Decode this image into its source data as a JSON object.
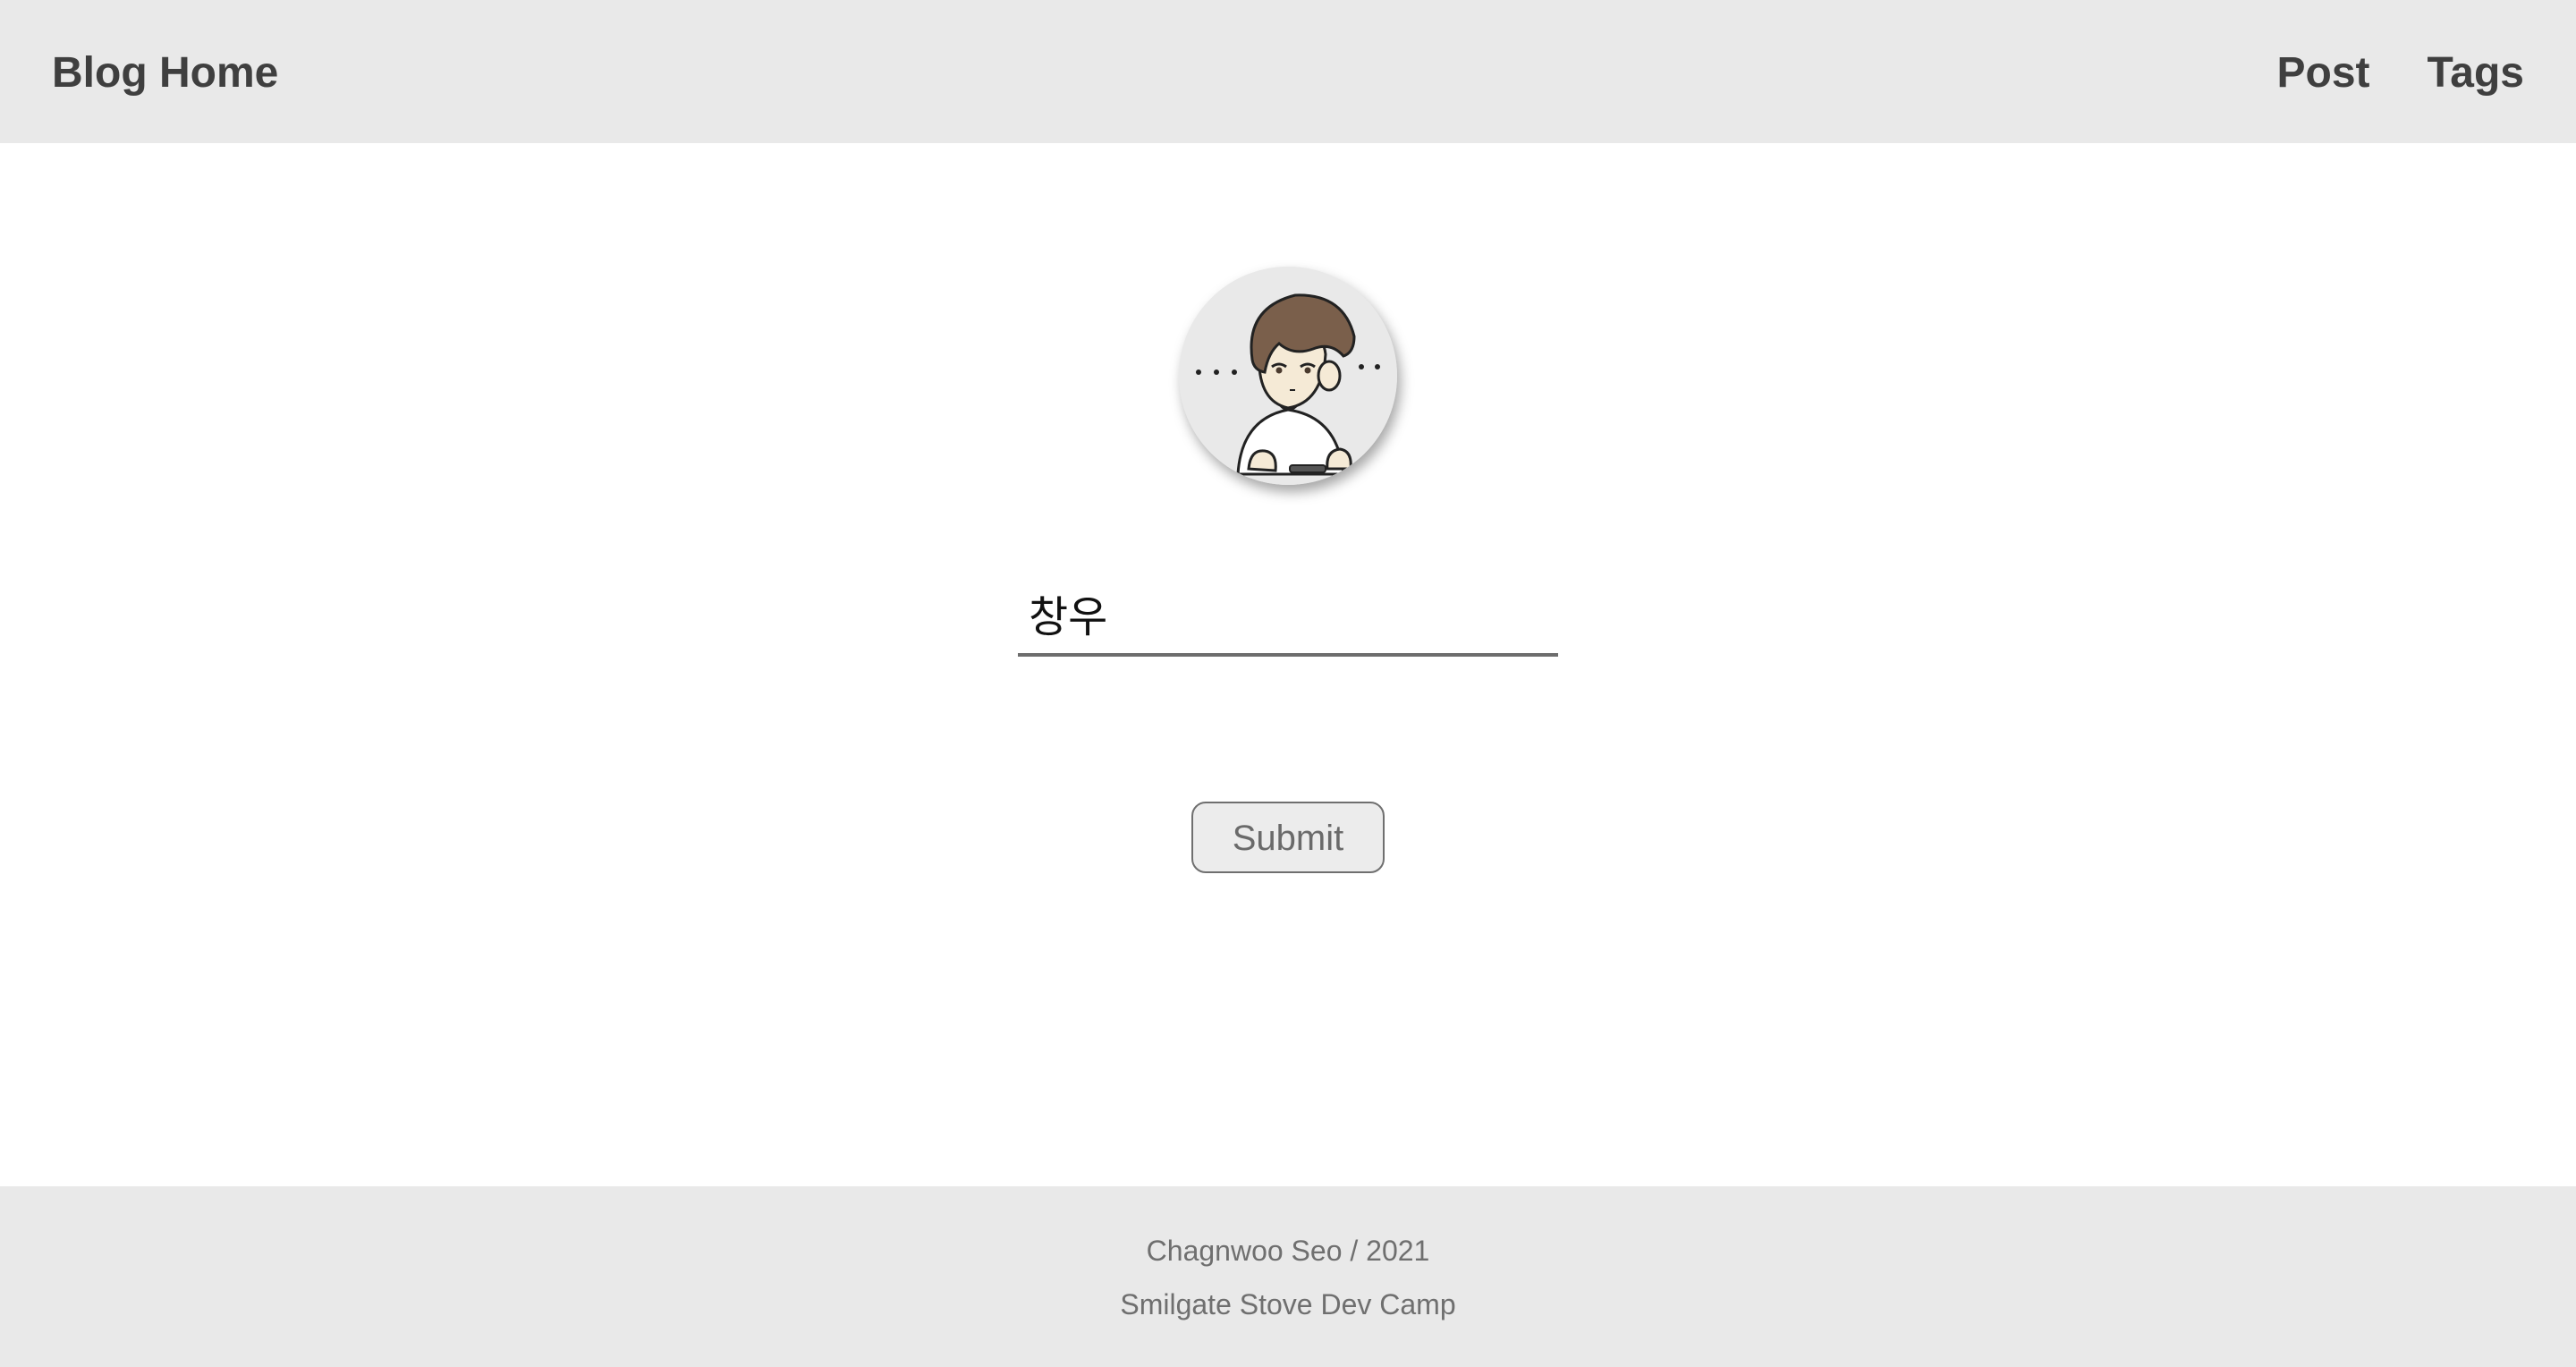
{
  "header": {
    "brand": "Blog Home",
    "nav": [
      {
        "label": "Post"
      },
      {
        "label": "Tags"
      }
    ]
  },
  "profile": {
    "avatar_icon": "user-avatar-illustration",
    "name_value": "창우"
  },
  "form": {
    "submit_label": "Submit"
  },
  "footer": {
    "line1": "Chagnwoo Seo / 2021",
    "line2": "Smilgate Stove Dev Camp"
  },
  "colors": {
    "bar_background": "#e9e9e9",
    "heading_text": "#3f3f3f",
    "muted_text": "#6f6f6f"
  }
}
